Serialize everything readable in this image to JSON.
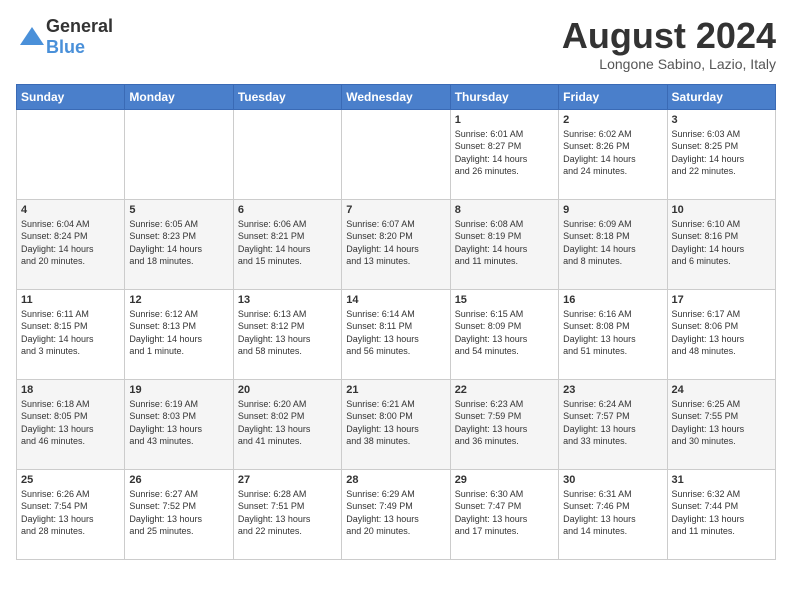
{
  "header": {
    "logo": {
      "general": "General",
      "blue": "Blue"
    },
    "title": "August 2024",
    "location": "Longone Sabino, Lazio, Italy"
  },
  "weekdays": [
    "Sunday",
    "Monday",
    "Tuesday",
    "Wednesday",
    "Thursday",
    "Friday",
    "Saturday"
  ],
  "weeks": [
    [
      {
        "day": "",
        "info": ""
      },
      {
        "day": "",
        "info": ""
      },
      {
        "day": "",
        "info": ""
      },
      {
        "day": "",
        "info": ""
      },
      {
        "day": "1",
        "info": "Sunrise: 6:01 AM\nSunset: 8:27 PM\nDaylight: 14 hours\nand 26 minutes."
      },
      {
        "day": "2",
        "info": "Sunrise: 6:02 AM\nSunset: 8:26 PM\nDaylight: 14 hours\nand 24 minutes."
      },
      {
        "day": "3",
        "info": "Sunrise: 6:03 AM\nSunset: 8:25 PM\nDaylight: 14 hours\nand 22 minutes."
      }
    ],
    [
      {
        "day": "4",
        "info": "Sunrise: 6:04 AM\nSunset: 8:24 PM\nDaylight: 14 hours\nand 20 minutes."
      },
      {
        "day": "5",
        "info": "Sunrise: 6:05 AM\nSunset: 8:23 PM\nDaylight: 14 hours\nand 18 minutes."
      },
      {
        "day": "6",
        "info": "Sunrise: 6:06 AM\nSunset: 8:21 PM\nDaylight: 14 hours\nand 15 minutes."
      },
      {
        "day": "7",
        "info": "Sunrise: 6:07 AM\nSunset: 8:20 PM\nDaylight: 14 hours\nand 13 minutes."
      },
      {
        "day": "8",
        "info": "Sunrise: 6:08 AM\nSunset: 8:19 PM\nDaylight: 14 hours\nand 11 minutes."
      },
      {
        "day": "9",
        "info": "Sunrise: 6:09 AM\nSunset: 8:18 PM\nDaylight: 14 hours\nand 8 minutes."
      },
      {
        "day": "10",
        "info": "Sunrise: 6:10 AM\nSunset: 8:16 PM\nDaylight: 14 hours\nand 6 minutes."
      }
    ],
    [
      {
        "day": "11",
        "info": "Sunrise: 6:11 AM\nSunset: 8:15 PM\nDaylight: 14 hours\nand 3 minutes."
      },
      {
        "day": "12",
        "info": "Sunrise: 6:12 AM\nSunset: 8:13 PM\nDaylight: 14 hours\nand 1 minute."
      },
      {
        "day": "13",
        "info": "Sunrise: 6:13 AM\nSunset: 8:12 PM\nDaylight: 13 hours\nand 58 minutes."
      },
      {
        "day": "14",
        "info": "Sunrise: 6:14 AM\nSunset: 8:11 PM\nDaylight: 13 hours\nand 56 minutes."
      },
      {
        "day": "15",
        "info": "Sunrise: 6:15 AM\nSunset: 8:09 PM\nDaylight: 13 hours\nand 54 minutes."
      },
      {
        "day": "16",
        "info": "Sunrise: 6:16 AM\nSunset: 8:08 PM\nDaylight: 13 hours\nand 51 minutes."
      },
      {
        "day": "17",
        "info": "Sunrise: 6:17 AM\nSunset: 8:06 PM\nDaylight: 13 hours\nand 48 minutes."
      }
    ],
    [
      {
        "day": "18",
        "info": "Sunrise: 6:18 AM\nSunset: 8:05 PM\nDaylight: 13 hours\nand 46 minutes."
      },
      {
        "day": "19",
        "info": "Sunrise: 6:19 AM\nSunset: 8:03 PM\nDaylight: 13 hours\nand 43 minutes."
      },
      {
        "day": "20",
        "info": "Sunrise: 6:20 AM\nSunset: 8:02 PM\nDaylight: 13 hours\nand 41 minutes."
      },
      {
        "day": "21",
        "info": "Sunrise: 6:21 AM\nSunset: 8:00 PM\nDaylight: 13 hours\nand 38 minutes."
      },
      {
        "day": "22",
        "info": "Sunrise: 6:23 AM\nSunset: 7:59 PM\nDaylight: 13 hours\nand 36 minutes."
      },
      {
        "day": "23",
        "info": "Sunrise: 6:24 AM\nSunset: 7:57 PM\nDaylight: 13 hours\nand 33 minutes."
      },
      {
        "day": "24",
        "info": "Sunrise: 6:25 AM\nSunset: 7:55 PM\nDaylight: 13 hours\nand 30 minutes."
      }
    ],
    [
      {
        "day": "25",
        "info": "Sunrise: 6:26 AM\nSunset: 7:54 PM\nDaylight: 13 hours\nand 28 minutes."
      },
      {
        "day": "26",
        "info": "Sunrise: 6:27 AM\nSunset: 7:52 PM\nDaylight: 13 hours\nand 25 minutes."
      },
      {
        "day": "27",
        "info": "Sunrise: 6:28 AM\nSunset: 7:51 PM\nDaylight: 13 hours\nand 22 minutes."
      },
      {
        "day": "28",
        "info": "Sunrise: 6:29 AM\nSunset: 7:49 PM\nDaylight: 13 hours\nand 20 minutes."
      },
      {
        "day": "29",
        "info": "Sunrise: 6:30 AM\nSunset: 7:47 PM\nDaylight: 13 hours\nand 17 minutes."
      },
      {
        "day": "30",
        "info": "Sunrise: 6:31 AM\nSunset: 7:46 PM\nDaylight: 13 hours\nand 14 minutes."
      },
      {
        "day": "31",
        "info": "Sunrise: 6:32 AM\nSunset: 7:44 PM\nDaylight: 13 hours\nand 11 minutes."
      }
    ]
  ]
}
